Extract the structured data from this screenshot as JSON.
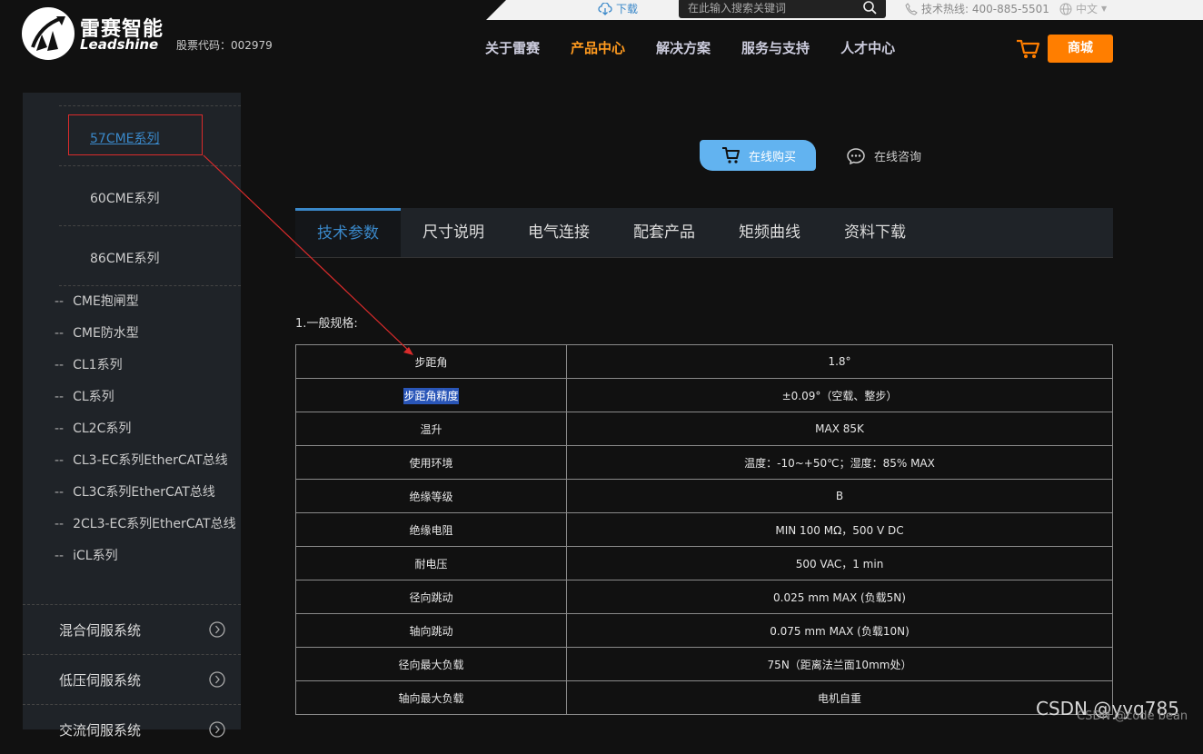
{
  "topbar": {
    "download_label": "下载",
    "search_placeholder": "在此输入搜索关键词",
    "hotline": "技术热线: 400-885-5501",
    "language": "中文"
  },
  "brand": {
    "name_cn": "雷赛智能",
    "name_en": "Leadshine",
    "stock_code": "股票代码：002979"
  },
  "nav": {
    "items": [
      "关于雷赛",
      "产品中心",
      "解决方案",
      "服务与支持",
      "人才中心"
    ],
    "active": "产品中心",
    "shop_label": "商城"
  },
  "sidebar": {
    "sub_items": [
      "57CME系列",
      "60CME系列",
      "86CME系列"
    ],
    "series": [
      "CME抱闸型",
      "CME防水型",
      "CL1系列",
      "CL系列",
      "CL2C系列",
      "CL3-EC系列EtherCAT总线",
      "CL3C系列EtherCAT总线",
      "2CL3-EC系列EtherCAT总线",
      "iCL系列"
    ],
    "series_prefix": "--",
    "categories": [
      "混合伺服系统",
      "低压伺服系统",
      "交流伺服系统"
    ]
  },
  "actions": {
    "buy_online": "在线购买",
    "consult_online": "在线咨询"
  },
  "tabs": [
    "技术参数",
    "尺寸说明",
    "电气连接",
    "配套产品",
    "矩频曲线",
    "资料下载"
  ],
  "spec": {
    "section_title": "1.一般规格:",
    "rows": [
      {
        "k": "步距角",
        "v": "1.8°"
      },
      {
        "k": "步距角精度",
        "v": "±0.09°（空载、整步）"
      },
      {
        "k": "温升",
        "v": "MAX 85K"
      },
      {
        "k": "使用环境",
        "v": "温度：-10~+50℃；湿度：85% MAX"
      },
      {
        "k": "绝缘等级",
        "v": "B"
      },
      {
        "k": "绝缘电阻",
        "v": "MIN 100 MΩ，500 V DC"
      },
      {
        "k": "耐电压",
        "v": "500 VAC，1 min"
      },
      {
        "k": "径向跳动",
        "v": "0.025 mm MAX (负载5N)"
      },
      {
        "k": "轴向跳动",
        "v": "0.075 mm MAX (负载10N)"
      },
      {
        "k": "径向最大负载",
        "v": "75N（距离法兰面10mm处）"
      },
      {
        "k": "轴向最大负载",
        "v": "电机自重"
      }
    ]
  },
  "watermark": "CSDN @yyq785",
  "watermark_under": "CSDN @code bean"
}
